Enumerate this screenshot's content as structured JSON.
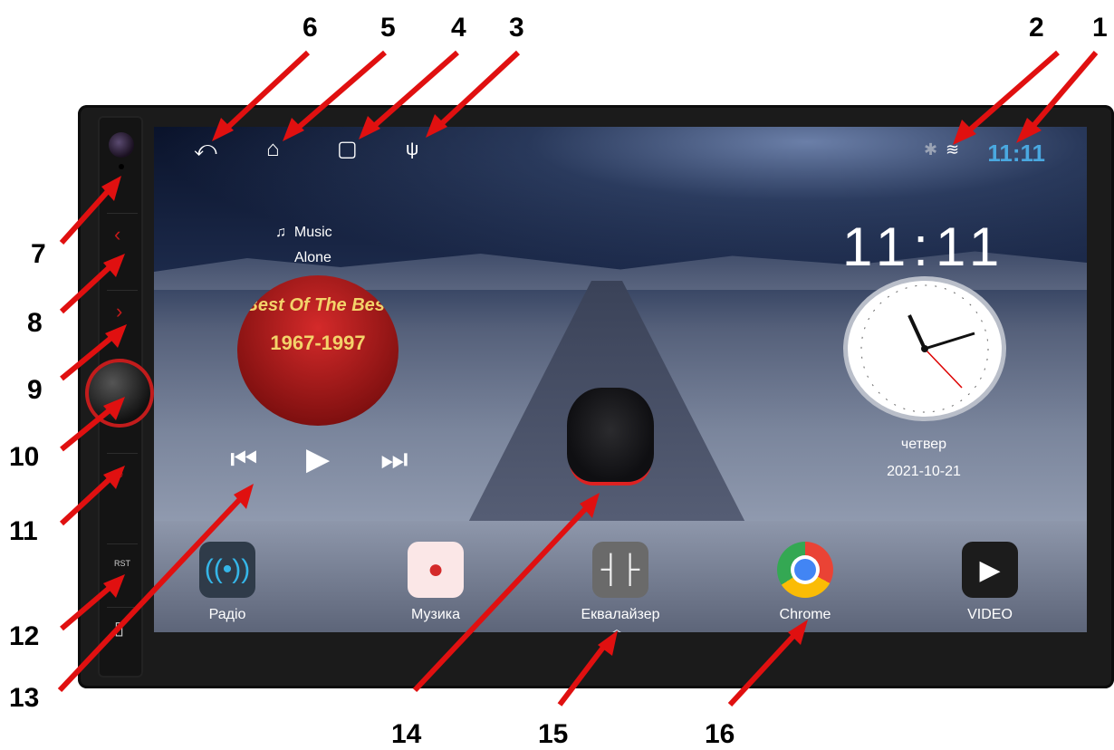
{
  "status_bar": {
    "back_icon": "back-arrow-icon",
    "home_icon": "home-icon",
    "recents_icon": "recents-icon",
    "usb_icon": "usb-icon",
    "bluetooth_icon": "bluetooth-icon",
    "wifi_icon": "wifi-icon",
    "time": "11:11"
  },
  "music_widget": {
    "label": "Music",
    "song": "Alone",
    "album_line1": "Best Of The Best",
    "album_line2": "1967-1997"
  },
  "clock_widget": {
    "time": "11:11",
    "day": "четвер",
    "date": "2021-10-21"
  },
  "apps": [
    {
      "label": "Радіо",
      "icon": "radio-icon"
    },
    {
      "label": "Музика",
      "icon": "music-icon"
    },
    {
      "label": "Еквалайзер",
      "icon": "equalizer-icon"
    },
    {
      "label": "Chrome",
      "icon": "chrome-icon"
    },
    {
      "label": "VIDEO",
      "icon": "video-icon"
    }
  ],
  "hardware": {
    "reset_label": "RST"
  },
  "callouts": [
    "1",
    "2",
    "3",
    "4",
    "5",
    "6",
    "7",
    "8",
    "9",
    "10",
    "11",
    "12",
    "13",
    "14",
    "15",
    "16"
  ],
  "colors": {
    "callout_arrow": "#e01010",
    "status_time": "#4aa8e0",
    "knob_ring": "#c21c1c"
  }
}
